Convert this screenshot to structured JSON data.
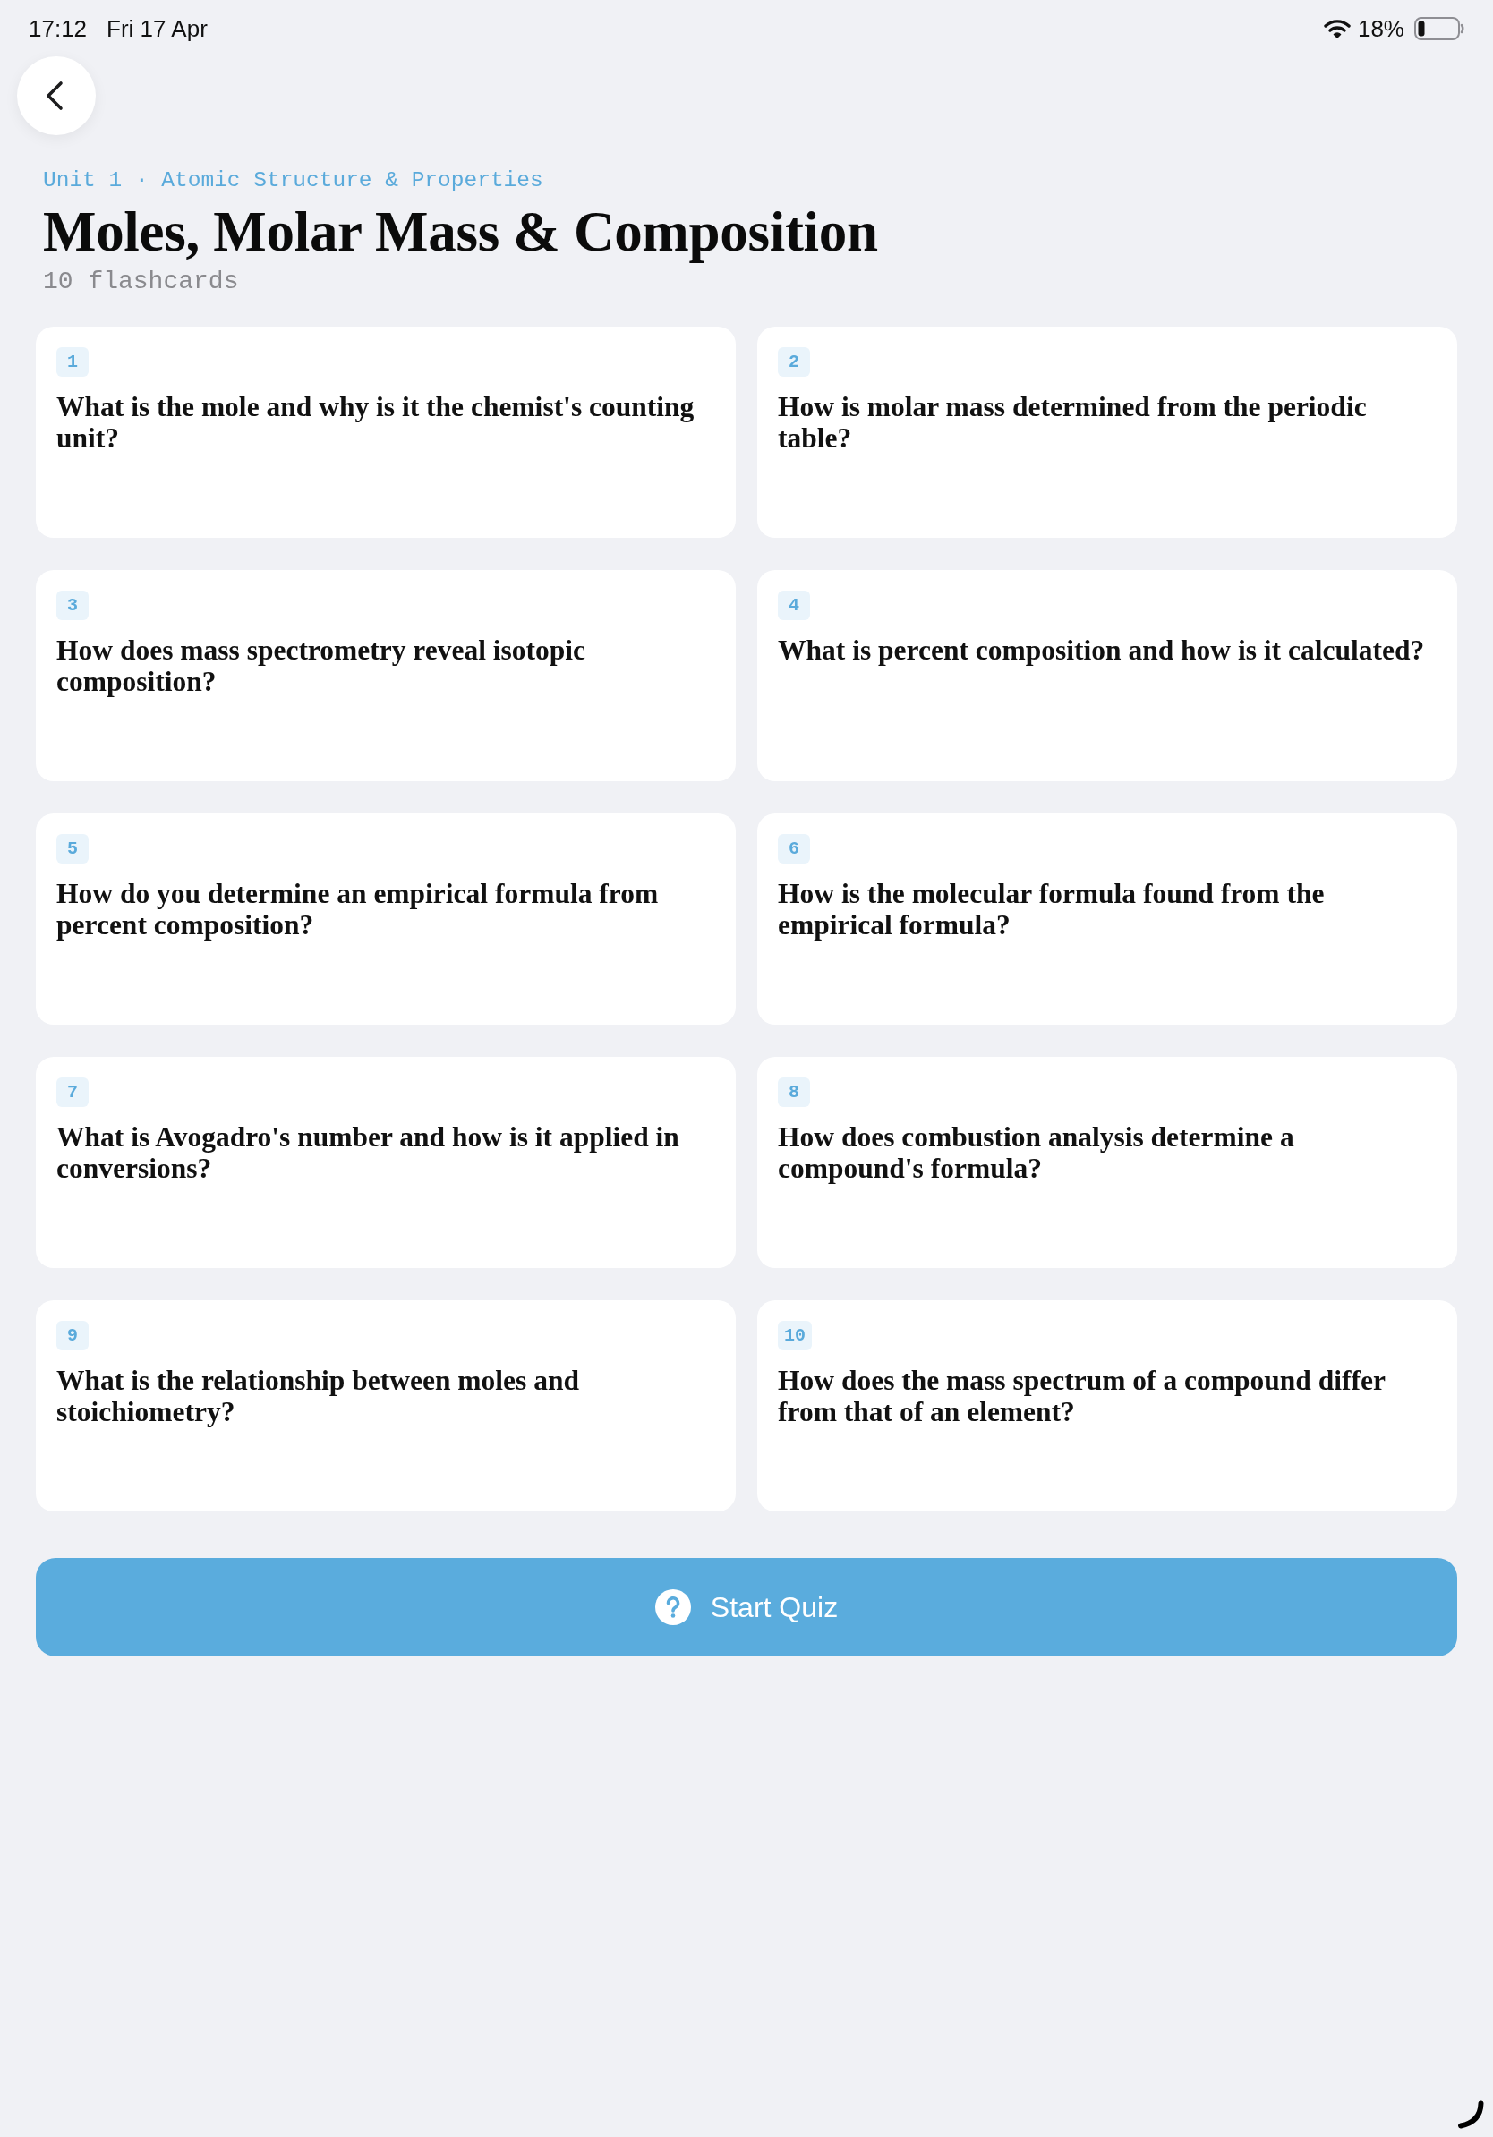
{
  "status_bar": {
    "time": "17:12",
    "date": "Fri 17 Apr",
    "battery_percent": "18%"
  },
  "header": {
    "breadcrumb": "Unit 1 · Atomic Structure & Properties",
    "title": "Moles, Molar Mass & Composition",
    "subtitle": "10 flashcards"
  },
  "cards": [
    {
      "number": "1",
      "question": "What is the mole and why is it the chemist's counting unit?"
    },
    {
      "number": "2",
      "question": "How is molar mass determined from the periodic table?"
    },
    {
      "number": "3",
      "question": "How does mass spectrometry reveal isotopic composition?"
    },
    {
      "number": "4",
      "question": "What is percent composition and how is it calculated?"
    },
    {
      "number": "5",
      "question": "How do you determine an empirical formula from percent composition?"
    },
    {
      "number": "6",
      "question": "How is the molecular formula found from the empirical formula?"
    },
    {
      "number": "7",
      "question": "What is Avogadro's number and how is it applied in conversions?"
    },
    {
      "number": "8",
      "question": "How does combustion analysis determine a compound's formula?"
    },
    {
      "number": "9",
      "question": "What is the relationship between moles and stoichiometry?"
    },
    {
      "number": "10",
      "question": "How does the mass spectrum of a compound differ from that of an element?"
    }
  ],
  "start_button": {
    "label": "Start Quiz"
  }
}
